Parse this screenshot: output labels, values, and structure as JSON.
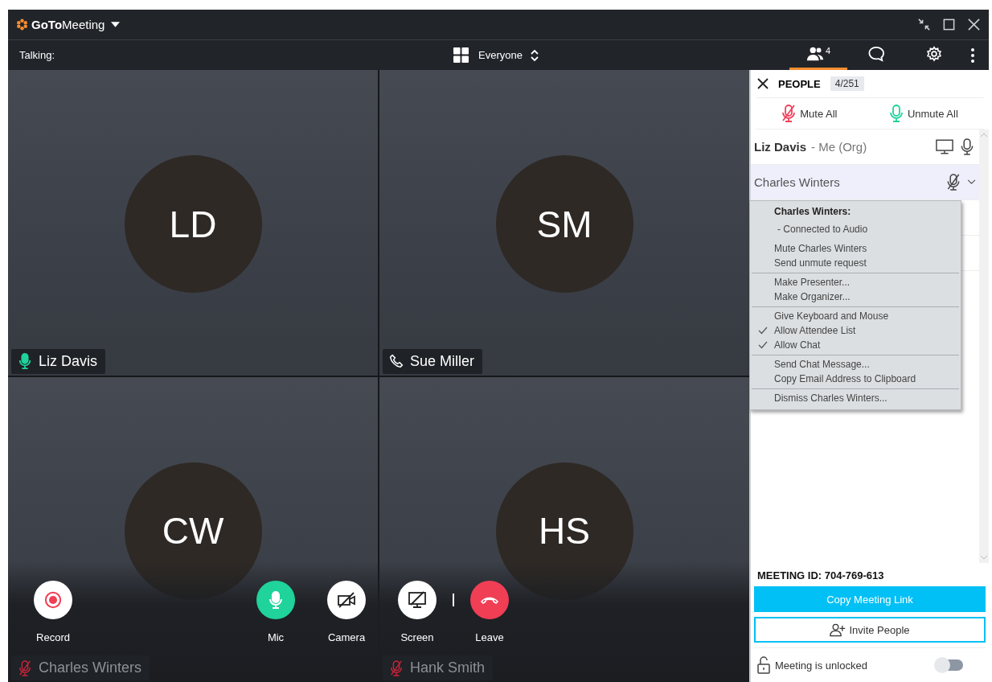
{
  "window": {
    "app_name": "**GoTo**Meeting"
  },
  "toolbar": {
    "talking_label": "Talking:",
    "view": "Everyone",
    "tabs": [
      {
        "kind": "people",
        "badge": "4",
        "selected": true
      },
      {
        "kind": "chat",
        "selected": false
      },
      {
        "kind": "settings",
        "selected": false
      }
    ]
  },
  "tiles": [
    {
      "initials": "LD",
      "name": "Liz Davis",
      "kind": "mic"
    },
    {
      "initials": "SM",
      "name": "Sue Miller",
      "kind": "phone"
    },
    {
      "initials": "CW",
      "name": "Charles Winters",
      "kind": "muted"
    },
    {
      "initials": "HS",
      "name": "Hank Smith",
      "kind": "muted"
    }
  ],
  "controls": [
    {
      "kind": "record",
      "label": "Record"
    },
    {
      "kind": "mic",
      "label": "Mic"
    },
    {
      "kind": "camera",
      "label": "Camera"
    },
    {
      "kind": "screen",
      "label": "Screen"
    },
    {
      "kind": "leave",
      "label": "Leave"
    }
  ],
  "panel": {
    "title": "PEOPLE",
    "count": "4/251",
    "mute_all": "Mute All",
    "unmute_all": "Unmute All",
    "participants": [
      {
        "name": "Liz Davis",
        "note": "- Me (Org)",
        "is_me": true,
        "muted": false,
        "sharing_screen": true,
        "selected": false
      },
      {
        "name": "Charles Winters",
        "is_me": false,
        "muted": true,
        "sharing_screen": false,
        "selected": true
      }
    ],
    "menu": {
      "title": "Charles Winters:",
      "status": "- Connected to Audio",
      "groups": [
        [
          {
            "label": "Mute Charles Winters",
            "checked": false
          },
          {
            "label": "Send unmute request",
            "checked": false
          }
        ],
        [
          {
            "label": "Make Presenter...",
            "checked": false
          },
          {
            "label": "Make Organizer...",
            "checked": false
          }
        ],
        [
          {
            "label": "Give Keyboard and Mouse",
            "checked": false
          },
          {
            "label": "Allow Attendee List",
            "checked": true
          },
          {
            "label": "Allow Chat",
            "checked": true
          }
        ],
        [
          {
            "label": "Send Chat Message...",
            "checked": false
          },
          {
            "label": "Copy Email Address to Clipboard",
            "checked": false
          }
        ],
        [
          {
            "label": "Dismiss Charles Winters...",
            "checked": false
          }
        ]
      ]
    },
    "meeting_id": "MEETING ID: 704-769-613",
    "copy_link": "Copy Meeting Link",
    "invite": "Invite People",
    "lock_label": "Meeting is unlocked",
    "locked": false
  }
}
